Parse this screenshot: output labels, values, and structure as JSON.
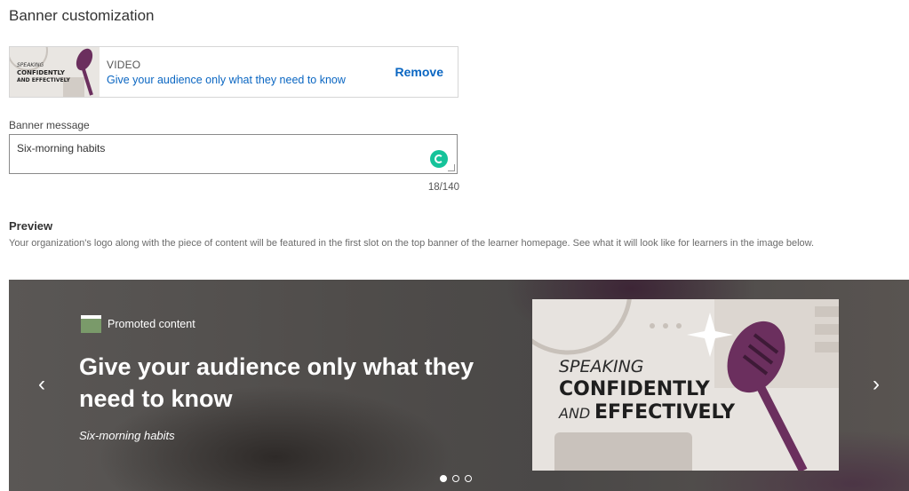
{
  "section": {
    "title": "Banner customization"
  },
  "video": {
    "type": "VIDEO",
    "title": "Give your audience only what they need to know",
    "remove_label": "Remove",
    "thumb_lines": [
      "SPEAKING",
      "CONFIDENTLY",
      "AND EFFECTIVELY"
    ]
  },
  "message": {
    "label": "Banner message",
    "value": "Six-morning habits",
    "count": "18/140"
  },
  "preview": {
    "title": "Preview",
    "description": "Your organization's logo along with the piece of content will be featured in the first slot on the top banner of the learner homepage. See what it will look like for learners in the image below."
  },
  "banner": {
    "prev_icon": "‹",
    "next_icon": "›",
    "promo_label": "Promoted content",
    "title": "Give your audience only what they need to know",
    "message": "Six-morning habits",
    "card_lines": [
      "SPEAKING",
      "CONFIDENTLY",
      "AND",
      "EFFECTIVELY"
    ],
    "dot_count": 3,
    "active_dot": 0
  },
  "colors": {
    "link": "#0a66c2",
    "grammarly": "#15c39a",
    "mic": "#6b2f5e",
    "card_bg": "#e7e3df"
  }
}
